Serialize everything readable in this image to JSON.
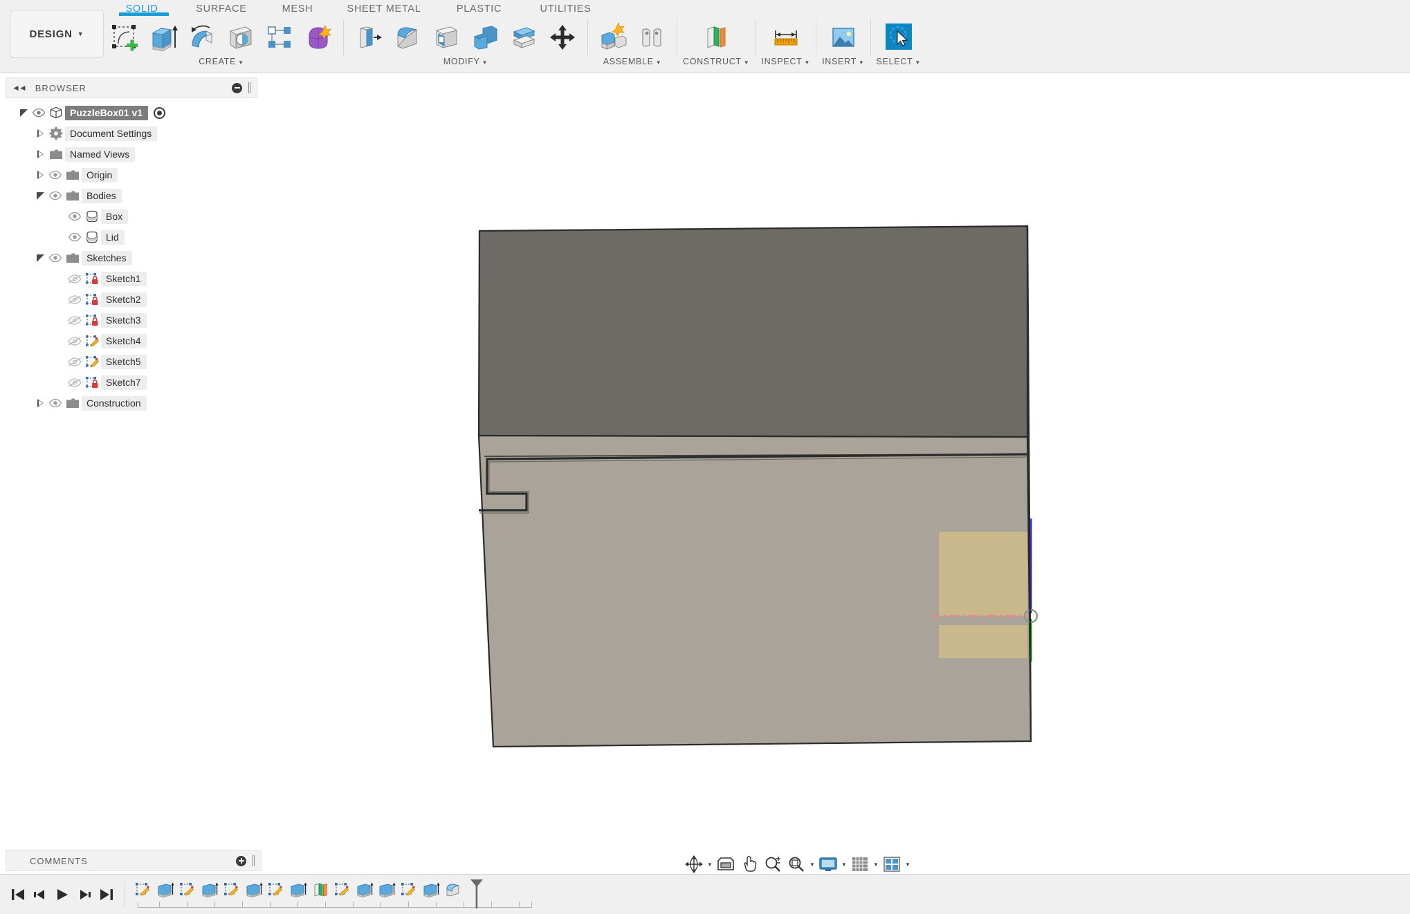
{
  "app": {
    "design_menu_label": "DESIGN",
    "accent_color": "#1b9bd8",
    "ribbon_bg": "#f0f0f0",
    "viewport_bg": "#ffffff"
  },
  "workspace_tabs": [
    {
      "label": "SOLID",
      "active": true
    },
    {
      "label": "SURFACE",
      "active": false
    },
    {
      "label": "MESH",
      "active": false
    },
    {
      "label": "SHEET METAL",
      "active": false
    },
    {
      "label": "PLASTIC",
      "active": false
    },
    {
      "label": "UTILITIES",
      "active": false
    }
  ],
  "tool_groups": [
    {
      "label": "CREATE",
      "has_caret": true,
      "tools": [
        {
          "name": "create-sketch-tool",
          "title": "Create Sketch"
        },
        {
          "name": "extrude-tool",
          "title": "Extrude"
        },
        {
          "name": "revolve-tool",
          "title": "Revolve"
        },
        {
          "name": "hole-tool",
          "title": "Hole"
        },
        {
          "name": "pattern-tool",
          "title": "Pattern"
        },
        {
          "name": "form-tool",
          "title": "Create Form"
        }
      ]
    },
    {
      "label": "MODIFY",
      "has_caret": true,
      "tools": [
        {
          "name": "press-pull-tool",
          "title": "Press Pull"
        },
        {
          "name": "fillet-tool",
          "title": "Fillet"
        },
        {
          "name": "shell-tool",
          "title": "Shell"
        },
        {
          "name": "combine-tool",
          "title": "Combine"
        },
        {
          "name": "split-body-tool",
          "title": "Split Body"
        },
        {
          "name": "move-copy-tool",
          "title": "Move/Copy"
        }
      ]
    },
    {
      "label": "ASSEMBLE",
      "has_caret": true,
      "tools": [
        {
          "name": "new-component-tool",
          "title": "New Component"
        },
        {
          "name": "joint-tool",
          "title": "Joint"
        }
      ]
    },
    {
      "label": "CONSTRUCT",
      "has_caret": true,
      "tools": [
        {
          "name": "offset-plane-tool",
          "title": "Offset Plane"
        }
      ]
    },
    {
      "label": "INSPECT",
      "has_caret": true,
      "tools": [
        {
          "name": "measure-tool",
          "title": "Measure"
        }
      ]
    },
    {
      "label": "INSERT",
      "has_caret": true,
      "tools": [
        {
          "name": "insert-image-tool",
          "title": "Canvas"
        }
      ]
    },
    {
      "label": "SELECT",
      "has_caret": true,
      "tools": [
        {
          "name": "select-tool",
          "title": "Select",
          "active": true
        }
      ]
    }
  ],
  "browser": {
    "title": "BROWSER",
    "collapse_icon": "double-chevron-left-icon",
    "minimize_icon": "minus-circle-icon",
    "tree": [
      {
        "label": "PuzzleBox01 v1",
        "indent": 0,
        "twisty": "open",
        "eye": "visible",
        "icon": "component-icon",
        "selected": true,
        "radio": true
      },
      {
        "label": "Document Settings",
        "indent": 1,
        "twisty": "closed",
        "eye": "none",
        "icon": "gear-icon"
      },
      {
        "label": "Named Views",
        "indent": 1,
        "twisty": "closed",
        "eye": "none",
        "icon": "folder-icon"
      },
      {
        "label": "Origin",
        "indent": 1,
        "twisty": "closed",
        "eye": "visible",
        "icon": "folder-icon"
      },
      {
        "label": "Bodies",
        "indent": 1,
        "twisty": "open",
        "eye": "visible",
        "icon": "folder-icon"
      },
      {
        "label": "Box",
        "indent": 2,
        "twisty": "none",
        "eye": "visible",
        "icon": "body-icon"
      },
      {
        "label": "Lid",
        "indent": 2,
        "twisty": "none",
        "eye": "visible",
        "icon": "body-icon"
      },
      {
        "label": "Sketches",
        "indent": 1,
        "twisty": "open",
        "eye": "visible",
        "icon": "folder-icon"
      },
      {
        "label": "Sketch1",
        "indent": 2,
        "twisty": "none",
        "eye": "hidden",
        "icon": "sketch-locked-icon"
      },
      {
        "label": "Sketch2",
        "indent": 2,
        "twisty": "none",
        "eye": "hidden",
        "icon": "sketch-locked-icon"
      },
      {
        "label": "Sketch3",
        "indent": 2,
        "twisty": "none",
        "eye": "hidden",
        "icon": "sketch-locked-icon"
      },
      {
        "label": "Sketch4",
        "indent": 2,
        "twisty": "none",
        "eye": "hidden",
        "icon": "sketch-edit-icon"
      },
      {
        "label": "Sketch5",
        "indent": 2,
        "twisty": "none",
        "eye": "hidden",
        "icon": "sketch-edit-icon"
      },
      {
        "label": "Sketch7",
        "indent": 2,
        "twisty": "none",
        "eye": "hidden",
        "icon": "sketch-locked-icon"
      },
      {
        "label": "Construction",
        "indent": 1,
        "twisty": "closed",
        "eye": "visible",
        "icon": "folder-icon"
      }
    ]
  },
  "comments": {
    "title": "COMMENTS",
    "add_icon": "plus-circle-icon"
  },
  "nav_bar": [
    {
      "name": "orbit-button",
      "caret": true
    },
    {
      "name": "look-at-button",
      "caret": false
    },
    {
      "name": "pan-button",
      "caret": false
    },
    {
      "name": "zoom-button",
      "caret": false
    },
    {
      "name": "fit-button",
      "caret": true
    },
    {
      "name": "display-settings-button",
      "caret": true
    },
    {
      "name": "grid-snaps-button",
      "caret": true
    },
    {
      "name": "viewports-button",
      "caret": true
    }
  ],
  "timeline": {
    "playback": [
      {
        "name": "go-to-beginning-button"
      },
      {
        "name": "step-back-button"
      },
      {
        "name": "play-button"
      },
      {
        "name": "step-forward-button"
      },
      {
        "name": "go-to-end-button"
      }
    ],
    "features": [
      {
        "name": "timeline-sketch-1",
        "type": "sketch"
      },
      {
        "name": "timeline-extrude-1",
        "type": "extrude"
      },
      {
        "name": "timeline-sketch-2",
        "type": "sketch"
      },
      {
        "name": "timeline-extrude-2",
        "type": "extrude"
      },
      {
        "name": "timeline-sketch-3",
        "type": "sketch"
      },
      {
        "name": "timeline-extrude-3",
        "type": "extrude"
      },
      {
        "name": "timeline-sketch-4",
        "type": "sketch"
      },
      {
        "name": "timeline-extrude-4",
        "type": "extrude"
      },
      {
        "name": "timeline-plane-1",
        "type": "plane"
      },
      {
        "name": "timeline-sketch-5",
        "type": "sketch"
      },
      {
        "name": "timeline-extrude-5",
        "type": "extrude"
      },
      {
        "name": "timeline-extrude-6",
        "type": "extrude"
      },
      {
        "name": "timeline-sketch-6",
        "type": "sketch"
      },
      {
        "name": "timeline-extrude-7",
        "type": "extrude"
      },
      {
        "name": "timeline-fillet-1",
        "type": "fillet"
      }
    ],
    "end_marker": "timeline-end-marker"
  },
  "viewport": {
    "model_name": "PuzzleBox01",
    "bodies": [
      {
        "name": "Lid",
        "face_color": "#6e6b66"
      },
      {
        "name": "Box",
        "face_color": "#a9a399"
      }
    ],
    "sketch_highlight_color": "#c8b88c",
    "construction_axis_color": "#e08a8a",
    "z_axis_color": "#3a34d8",
    "y_axis_color": "#00b400",
    "edge_color": "#2b2b2b"
  }
}
